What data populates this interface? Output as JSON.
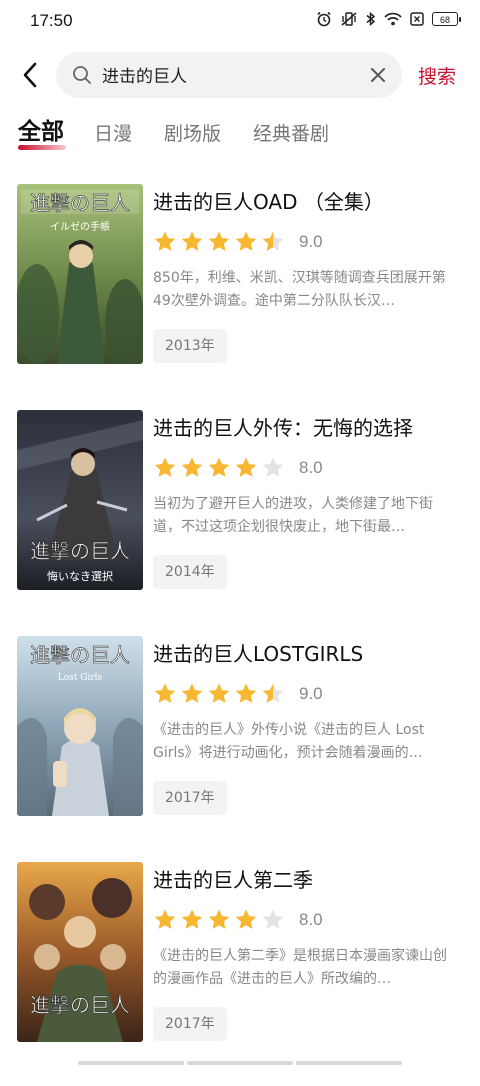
{
  "status_bar": {
    "time": "17:50",
    "battery": "68",
    "icons": [
      "alarm-icon",
      "mute-vibrate-icon",
      "bluetooth-icon",
      "wifi-icon",
      "sim-off-icon",
      "battery-icon"
    ]
  },
  "search": {
    "query": "进击的巨人",
    "submit_label": "搜索"
  },
  "tabs": [
    {
      "label": "全部",
      "active": true
    },
    {
      "label": "日漫",
      "active": false
    },
    {
      "label": "剧场版",
      "active": false
    },
    {
      "label": "经典番剧",
      "active": false
    }
  ],
  "colors": {
    "accent": "#c8102e",
    "star_filled": "#f7b731",
    "star_empty": "#e3e3e3"
  },
  "results": [
    {
      "title": "进击的巨人OAD （全集）",
      "stars": 4.5,
      "score": "9.0",
      "description": "850年，利维、米凯、汉琪等随调查兵团展开第49次壁外调查。途中第二分队队长汉…",
      "year": "2013年",
      "poster_text": "進撃の巨人",
      "poster_subtext": "イルゼの手帳"
    },
    {
      "title": "进击的巨人外传：无悔的选择",
      "stars": 4,
      "score": "8.0",
      "description": "当初为了避开巨人的进攻，人类修建了地下街道，不过这项企划很快废止，地下街最…",
      "year": "2014年",
      "poster_text": "進撃の巨人",
      "poster_subtext": "悔いなき選択"
    },
    {
      "title": "进击的巨人LOSTGIRLS",
      "stars": 4.5,
      "score": "9.0",
      "description": "《进击的巨人》外传小说《进击的巨人 Lost Girls》将进行动画化，预计会随着漫画的…",
      "year": "2017年",
      "poster_text": "進撃の巨人",
      "poster_subtext": "Lost Girls"
    },
    {
      "title": "进击的巨人第二季",
      "stars": 4,
      "score": "8.0",
      "description": "《进击的巨人第二季》是根据日本漫画家谏山创的漫画作品《进击的巨人》所改编的…",
      "year": "2017年",
      "poster_text": "進撃の巨人",
      "poster_subtext": ""
    }
  ]
}
